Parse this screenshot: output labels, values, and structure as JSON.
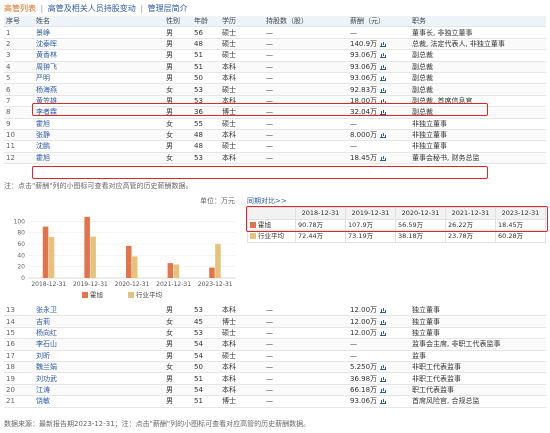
{
  "nav": {
    "tab1": "高管列表",
    "tab2": "高管及相关人员持股变动",
    "tab3": "管理层简介"
  },
  "colors": {
    "accent_red": "#e0262c",
    "bar_exec": "#e3734a",
    "bar_avg": "#e6c27a",
    "link": "#2b5aa8"
  },
  "table": {
    "headers": [
      "序号",
      "姓名",
      "性别",
      "年龄",
      "学历",
      "持股数（股）",
      "薪酬（元）",
      "职务"
    ],
    "rows_top": [
      [
        "1",
        "景峥",
        "男",
        "56",
        "硕士",
        "—",
        "—",
        "董事长, 非独立董事"
      ],
      [
        "2",
        "沈泰晖",
        "男",
        "48",
        "硕士",
        "—",
        "140.9万",
        "总裁, 法定代表人, 非独立董事"
      ],
      [
        "3",
        "黄香林",
        "男",
        "51",
        "硕士",
        "—",
        "93.06万",
        "副总裁"
      ],
      [
        "4",
        "周翀飞",
        "男",
        "51",
        "本科",
        "—",
        "93.06万",
        "副总裁"
      ],
      [
        "5",
        "严明",
        "男",
        "50",
        "本科",
        "—",
        "93.06万",
        "副总裁"
      ],
      [
        "6",
        "杨海燕",
        "女",
        "53",
        "硕士",
        "—",
        "92.83万",
        "副总裁"
      ],
      [
        "7",
        "黄笠雄",
        "男",
        "53",
        "本科",
        "—",
        "18.00万",
        "副总裁, 首席信息官"
      ],
      [
        "8",
        "李者霖",
        "男",
        "36",
        "博士",
        "—",
        "32.04万",
        "副总裁"
      ],
      [
        "9",
        "霍旭",
        "女",
        "55",
        "硕士",
        "—",
        "—",
        "非独立董事"
      ],
      [
        "10",
        "张静",
        "女",
        "48",
        "本科",
        "—",
        "8.000万",
        "非独立董事"
      ],
      [
        "11",
        "沈鹏",
        "男",
        "48",
        "硕士",
        "—",
        "—",
        "非独立董事"
      ],
      [
        "12",
        "霍旭",
        "女",
        "53",
        "本科",
        "—",
        "18.45万",
        "董事会秘书, 财务总监"
      ]
    ],
    "rows_bottom": [
      [
        "13",
        "张永卫",
        "男",
        "53",
        "本科",
        "—",
        "12.00万",
        "独立董事"
      ],
      [
        "14",
        "吉莉",
        "女",
        "45",
        "博士",
        "—",
        "12.00万",
        "独立董事"
      ],
      [
        "15",
        "杨向红",
        "女",
        "53",
        "硕士",
        "—",
        "12.00万",
        "独立董事"
      ],
      [
        "16",
        "李石山",
        "男",
        "54",
        "本科",
        "—",
        "—",
        "监事会主席, 非职工代表监事"
      ],
      [
        "17",
        "刘昕",
        "男",
        "54",
        "硕士",
        "—",
        "—",
        "监事"
      ],
      [
        "18",
        "魏兰娟",
        "女",
        "50",
        "本科",
        "—",
        "5.250万",
        "非职工代表监事"
      ],
      [
        "19",
        "刘功武",
        "男",
        "51",
        "本科",
        "—",
        "36.98万",
        "非职工代表监事"
      ],
      [
        "20",
        "江涛",
        "男",
        "54",
        "本科",
        "—",
        "66.18万",
        "职工代表监事"
      ],
      [
        "21",
        "饶敏",
        "男",
        "51",
        "博士",
        "—",
        "93.06万",
        "首席风险官, 合规总监"
      ]
    ]
  },
  "note_mid": "注：点击\"薪酬\"列的小图标可查看对应高管的历史薪酬数据。",
  "note_bottom": "数据来源：最新报告期2023-12-31；注：点击\"薪酬\"列的小图标可查看对应高管的历史薪酬数据。",
  "chart_data": {
    "type": "bar",
    "unit": "单位：万元",
    "categories": [
      "2018-12-31",
      "2019-12-31",
      "2020-12-31",
      "2021-12-31",
      "2023-12-31"
    ],
    "ylim": [
      0,
      120
    ],
    "yticks": [
      0,
      20,
      40,
      60,
      80,
      100
    ],
    "series": [
      {
        "name": "霍旭",
        "values": [
          90.78,
          107.9,
          56.59,
          26.22,
          18.45
        ]
      },
      {
        "name": "行业平均",
        "values": [
          72.44,
          73.19,
          38.18,
          23.78,
          60.28
        ]
      }
    ]
  },
  "compare": {
    "button": "同期对比>>",
    "headers": [
      "",
      "2018-12-31",
      "2019-12-31",
      "2020-12-31",
      "2021-12-31",
      "2023-12-31"
    ],
    "rows": [
      [
        "霍旭",
        "90.78万",
        "107.9万",
        "56.59万",
        "26.22万",
        "18.45万"
      ],
      [
        "行业平均",
        "72.44万",
        "73.19万",
        "38.18万",
        "23.78万",
        "60.28万"
      ]
    ]
  }
}
